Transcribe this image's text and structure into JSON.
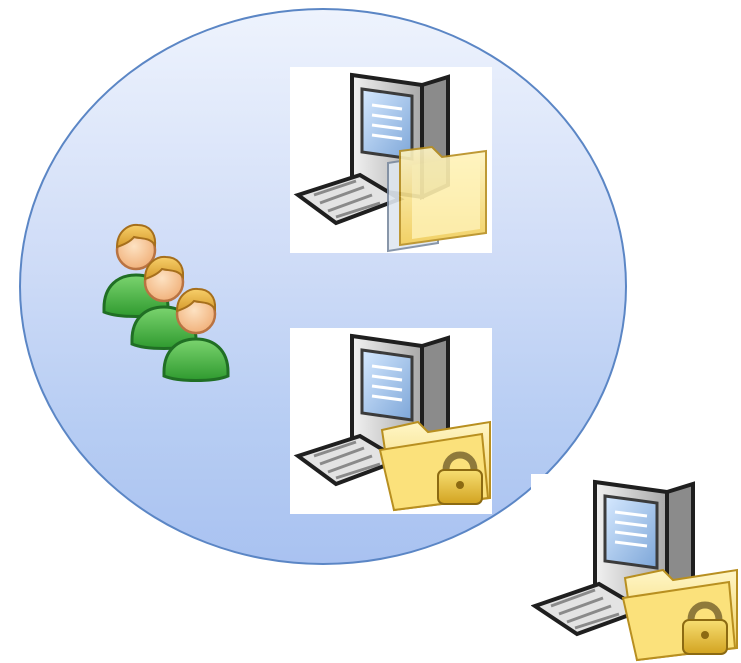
{
  "diagram": {
    "circle_fill_top": "#eef3fd",
    "circle_fill_bottom": "#a9c2f1",
    "circle_border": "#5b86c5"
  },
  "users": {
    "icon": "user-group-icon",
    "count": 3
  },
  "computers": [
    {
      "icon": "computer-shared-folder-icon",
      "inside_circle": true
    },
    {
      "icon": "computer-locked-folder-icon",
      "inside_circle": true
    },
    {
      "icon": "computer-locked-folder-icon",
      "inside_circle": false
    }
  ]
}
